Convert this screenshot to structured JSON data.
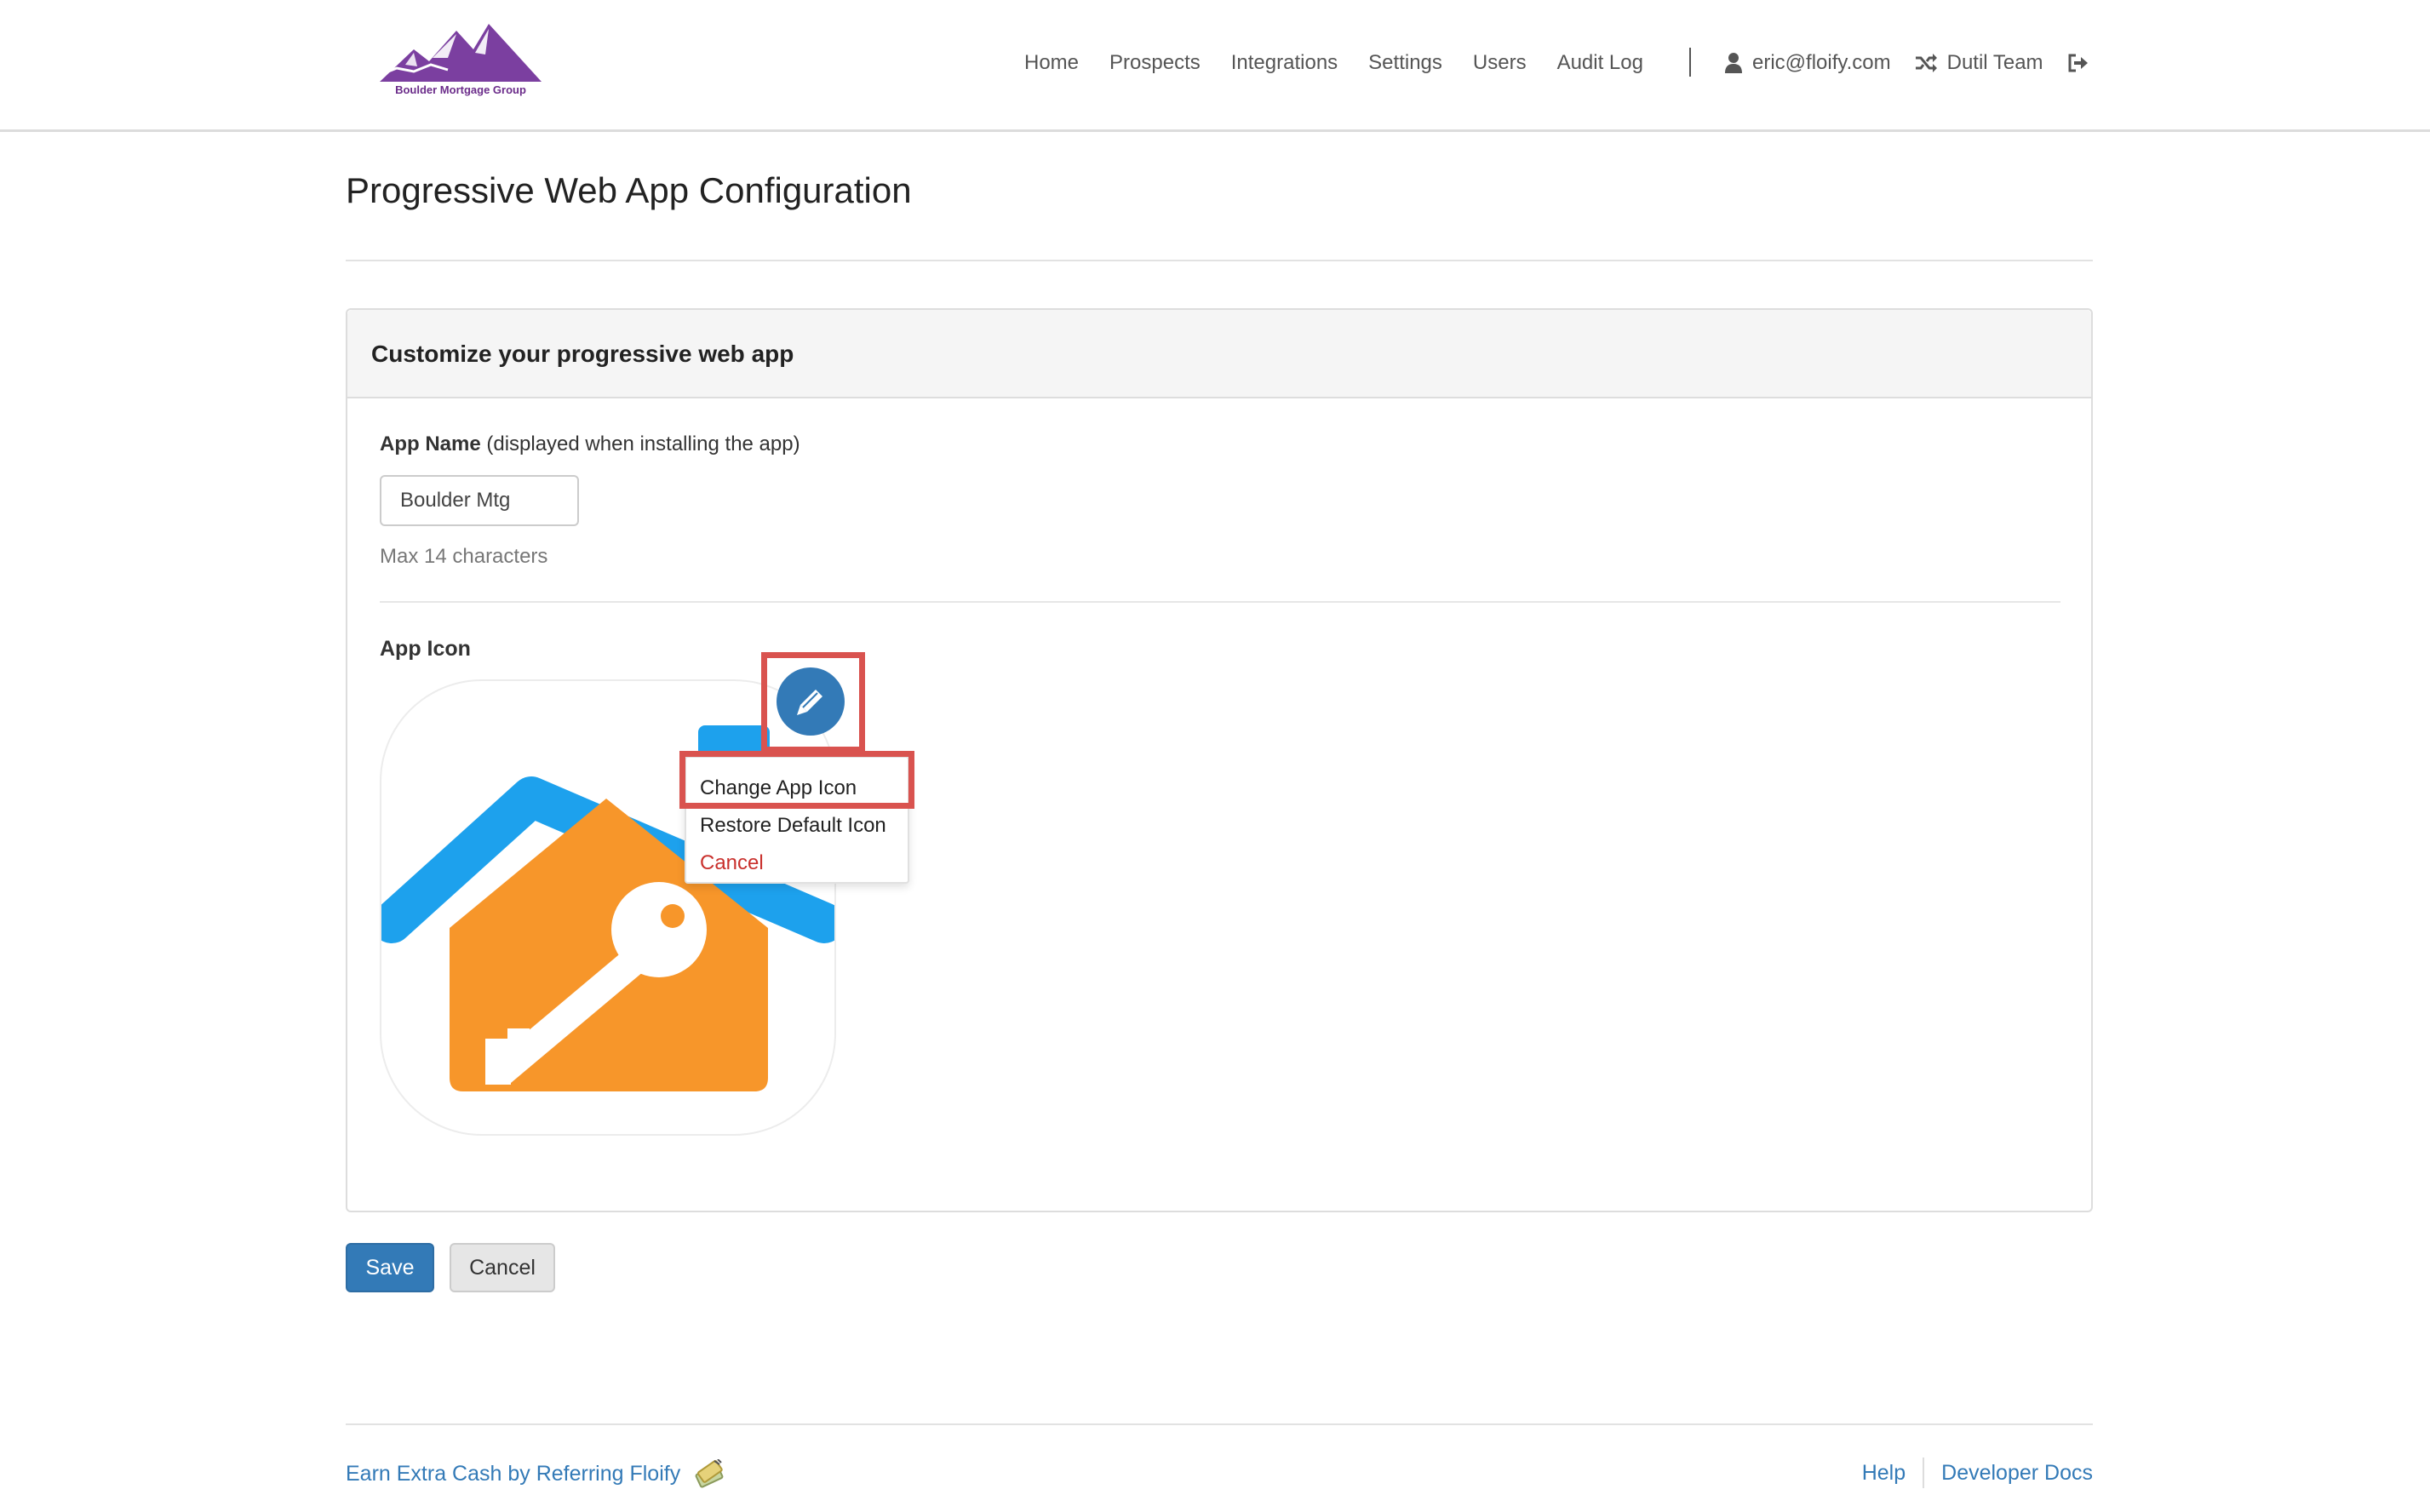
{
  "brand": {
    "logo_text": "Boulder Mortgage Group",
    "logo_color": "#7b3fa0"
  },
  "nav": {
    "items": [
      "Home",
      "Prospects",
      "Integrations",
      "Settings",
      "Users",
      "Audit Log"
    ],
    "user_email": "eric@floify.com",
    "team_name": "Dutil Team"
  },
  "page": {
    "title": "Progressive Web App Configuration"
  },
  "panel": {
    "heading": "Customize your progressive web app",
    "app_name_label": "App Name",
    "app_name_hint": "(displayed when installing the app)",
    "app_name_value": "Boulder Mtg",
    "app_name_help": "Max 14 characters",
    "app_icon_label": "App Icon"
  },
  "icon_menu": {
    "change": "Change App Icon",
    "restore": "Restore Default Icon",
    "cancel": "Cancel"
  },
  "actions": {
    "save": "Save",
    "cancel": "Cancel"
  },
  "footer": {
    "referral": "Earn Extra Cash by Referring Floify",
    "help": "Help",
    "developer_docs": "Developer Docs"
  },
  "colors": {
    "primary": "#337ab7",
    "highlight": "#d9534f",
    "danger": "#c9302c",
    "roof_blue": "#1da1ed",
    "house_orange": "#f7962a"
  }
}
